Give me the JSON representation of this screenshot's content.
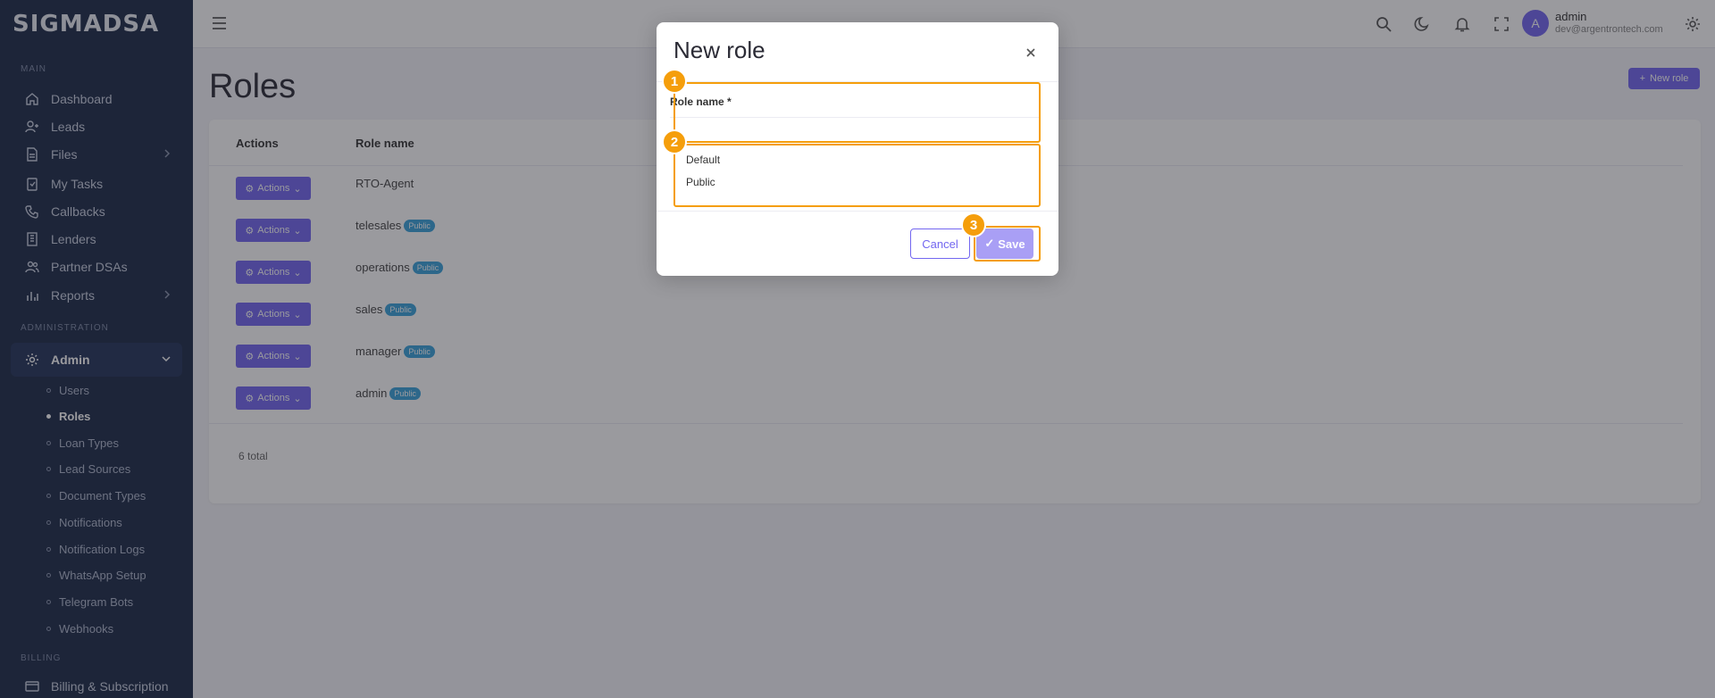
{
  "app": {
    "logo": "SIGMADSA"
  },
  "sidebar": {
    "sections": {
      "main": "MAIN",
      "administration": "ADMINISTRATION",
      "billing": "BILLING"
    },
    "main_items": [
      {
        "label": "Dashboard",
        "icon": "home-icon"
      },
      {
        "label": "Leads",
        "icon": "user-plus-icon"
      },
      {
        "label": "Files",
        "icon": "file-icon"
      },
      {
        "label": "My Tasks",
        "icon": "task-icon"
      },
      {
        "label": "Callbacks",
        "icon": "phone-icon"
      },
      {
        "label": "Lenders",
        "icon": "building-icon"
      },
      {
        "label": "Partner DSAs",
        "icon": "users-icon"
      },
      {
        "label": "Reports",
        "icon": "chart-icon"
      }
    ],
    "admin": {
      "label": "Admin",
      "items": [
        "Users",
        "Roles",
        "Loan Types",
        "Lead Sources",
        "Document Types",
        "Notifications",
        "Notification Logs",
        "WhatsApp Setup",
        "Telegram Bots",
        "Webhooks"
      ],
      "active": "Roles"
    },
    "billing_item": "Billing & Subscription"
  },
  "header": {
    "user": {
      "initial": "A",
      "name": "admin",
      "email": "dev@argentrontech.com"
    }
  },
  "page": {
    "title": "Roles",
    "new_button": "New role",
    "table": {
      "headers": [
        "Actions",
        "Role name"
      ],
      "action_label": "Actions",
      "public_badge": "Public",
      "rows": [
        {
          "name": "RTO-Agent",
          "public": false
        },
        {
          "name": "telesales",
          "public": true
        },
        {
          "name": "operations",
          "public": true
        },
        {
          "name": "sales",
          "public": true
        },
        {
          "name": "manager",
          "public": true
        },
        {
          "name": "admin",
          "public": true
        }
      ],
      "total": "6 total"
    }
  },
  "modal": {
    "title": "New role",
    "field_label": "Role name *",
    "field_value": "",
    "options": [
      "Default",
      "Public"
    ],
    "cancel": "Cancel",
    "save": "Save"
  },
  "annotations": [
    "1",
    "2",
    "3"
  ],
  "colors": {
    "sidebar": "#1c2a48",
    "accent": "#7367f0",
    "badge": "#39a2db",
    "annotation": "#f59e0b"
  }
}
